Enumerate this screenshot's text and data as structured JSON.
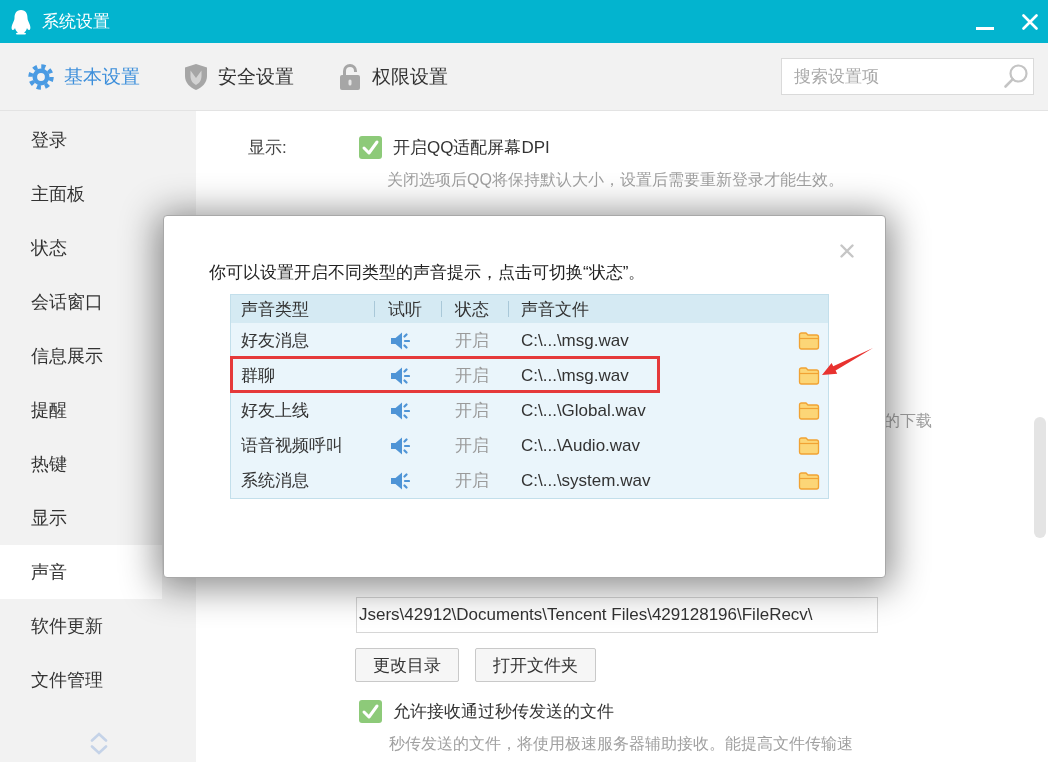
{
  "window": {
    "title": "系统设置"
  },
  "tabs": [
    {
      "label": "基本设置",
      "selected": true
    },
    {
      "label": "安全设置",
      "selected": false
    },
    {
      "label": "权限设置",
      "selected": false
    }
  ],
  "search": {
    "placeholder": "搜索设置项"
  },
  "sidebar": {
    "items": [
      {
        "label": "登录",
        "selected": false
      },
      {
        "label": "主面板",
        "selected": false
      },
      {
        "label": "状态",
        "selected": false
      },
      {
        "label": "会话窗口",
        "selected": false
      },
      {
        "label": "信息展示",
        "selected": false
      },
      {
        "label": "提醒",
        "selected": false
      },
      {
        "label": "热键",
        "selected": false
      },
      {
        "label": "显示",
        "selected": false
      },
      {
        "label": "声音",
        "selected": true
      },
      {
        "label": "软件更新",
        "selected": false
      },
      {
        "label": "文件管理",
        "selected": false
      }
    ]
  },
  "display_section": {
    "label": "显示:",
    "option": {
      "label": "开启QQ适配屏幕DPI",
      "checked": true
    },
    "hint": "关闭选项后QQ将保持默认大小，设置后需要重新登录才能生效。"
  },
  "covered_line": {
    "text": "的下载"
  },
  "file_section": {
    "path_field": {
      "value": "Jsers\\42912\\Documents\\Tencent Files\\429128196\\FileRecv\\"
    },
    "buttons": [
      "更改目录",
      "打开文件夹"
    ],
    "option": {
      "label": "允许接收通过秒传发送的文件",
      "checked": true
    },
    "hint": "秒传发送的文件，将使用极速服务器辅助接收。能提高文件传输速"
  },
  "dialog": {
    "message": "你可以设置开启不同类型的声音提示，点击可切换“状态”。",
    "table": {
      "columns": [
        "声音类型",
        "试听",
        "状态",
        "声音文件"
      ],
      "rows": [
        {
          "type": "好友消息",
          "status": "开启",
          "file": "C:\\...\\msg.wav",
          "marked": false
        },
        {
          "type": "群聊",
          "status": "开启",
          "file": "C:\\...\\msg.wav",
          "marked": true
        },
        {
          "type": "好友上线",
          "status": "开启",
          "file": "C:\\...\\Global.wav",
          "marked": false
        },
        {
          "type": "语音视频呼叫",
          "status": "开启",
          "file": "C:\\...\\Audio.wav",
          "marked": false
        },
        {
          "type": "系统消息",
          "status": "开启",
          "file": "C:\\...\\system.wav",
          "marked": false
        }
      ]
    }
  }
}
